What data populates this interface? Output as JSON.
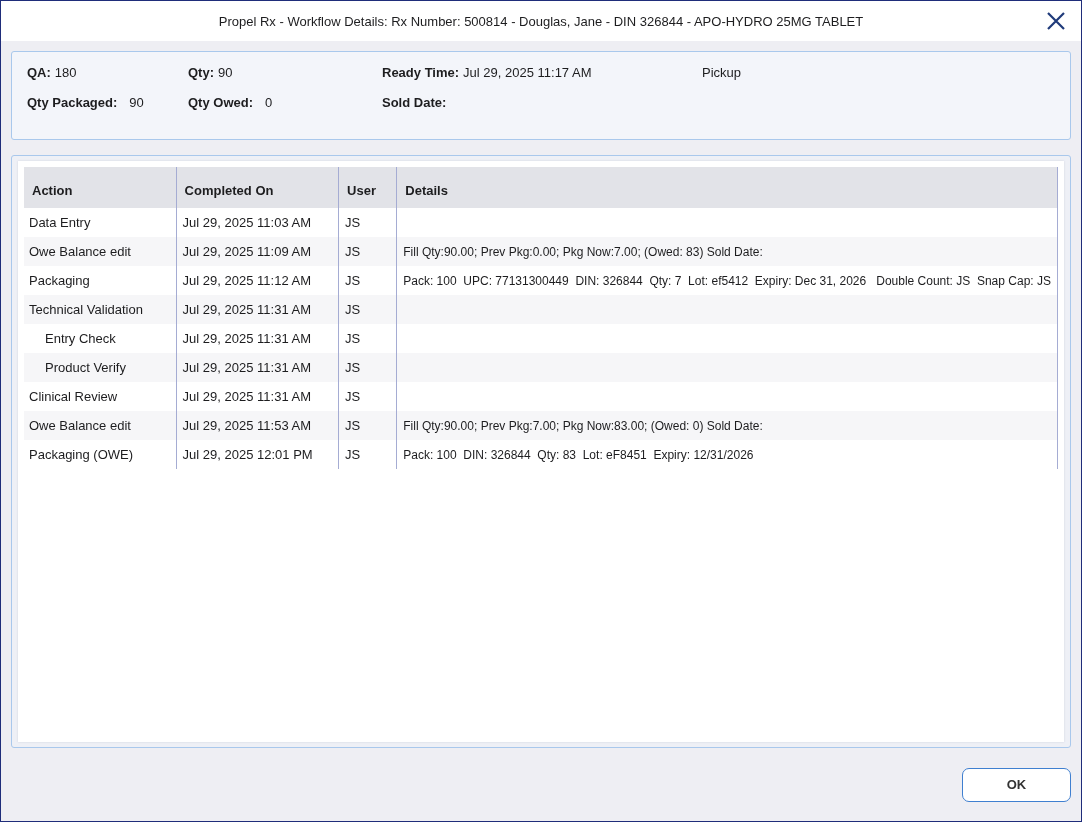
{
  "window": {
    "title": "Propel Rx - Workflow Details: Rx Number: 500814 - Douglas, Jane - DIN 326844 - APO-HYDRO 25MG TABLET"
  },
  "summary": {
    "rows": [
      [
        {
          "label": "QA:",
          "value": "180"
        },
        {
          "label": "Qty:",
          "value": "90"
        },
        {
          "label": "Ready Time:",
          "value": "Jul 29, 2025 11:17 AM"
        },
        {
          "value": "Pickup"
        }
      ],
      [
        {
          "label": "Qty Packaged:",
          "value": "90"
        },
        {
          "label": "Qty Owed:",
          "value": "0"
        },
        {
          "label": "Sold Date:"
        }
      ]
    ]
  },
  "table": {
    "columns": [
      "Action",
      "Completed On",
      "User",
      "Details"
    ],
    "rows": [
      {
        "action": "Data Entry",
        "completed_on": "Jul 29, 2025 11:03 AM",
        "user": "JS"
      },
      {
        "action": "Owe Balance edit",
        "completed_on": "Jul 29, 2025 11:09 AM",
        "user": "JS",
        "details": "Fill Qty:90.00; Prev Pkg:0.00; Pkg Now:7.00; (Owed: 83) Sold Date:"
      },
      {
        "action": "Packaging",
        "completed_on": "Jul 29, 2025 11:12 AM",
        "user": "JS",
        "details": "Pack: 100  UPC: 77131300449  DIN: 326844  Qty: 7  Lot: ef5412  Expiry: Dec 31, 2026   Double Count: JS  Snap Cap: JS"
      },
      {
        "action": "Technical Validation",
        "completed_on": "Jul 29, 2025 11:31 AM",
        "user": "JS",
        "children": [
          {
            "action": "Entry Check",
            "completed_on": "Jul 29, 2025 11:31 AM",
            "user": "JS"
          },
          {
            "action": "Product Verify",
            "completed_on": "Jul 29, 2025 11:31 AM",
            "user": "JS"
          }
        ]
      },
      {
        "action": "Clinical Review",
        "completed_on": "Jul 29, 2025 11:31 AM",
        "user": "JS"
      },
      {
        "action": "Owe Balance edit",
        "completed_on": "Jul 29, 2025 11:53 AM",
        "user": "JS",
        "details": "Fill Qty:90.00; Prev Pkg:7.00; Pkg Now:83.00; (Owed: 0) Sold Date:"
      },
      {
        "action": "Packaging (OWE)",
        "completed_on": "Jul 29, 2025 12:01 PM",
        "user": "JS",
        "details": "Pack: 100  DIN: 326844  Qty: 83  Lot: eF8451  Expiry: 12/31/2026"
      }
    ]
  },
  "buttons": [
    "OK"
  ]
}
